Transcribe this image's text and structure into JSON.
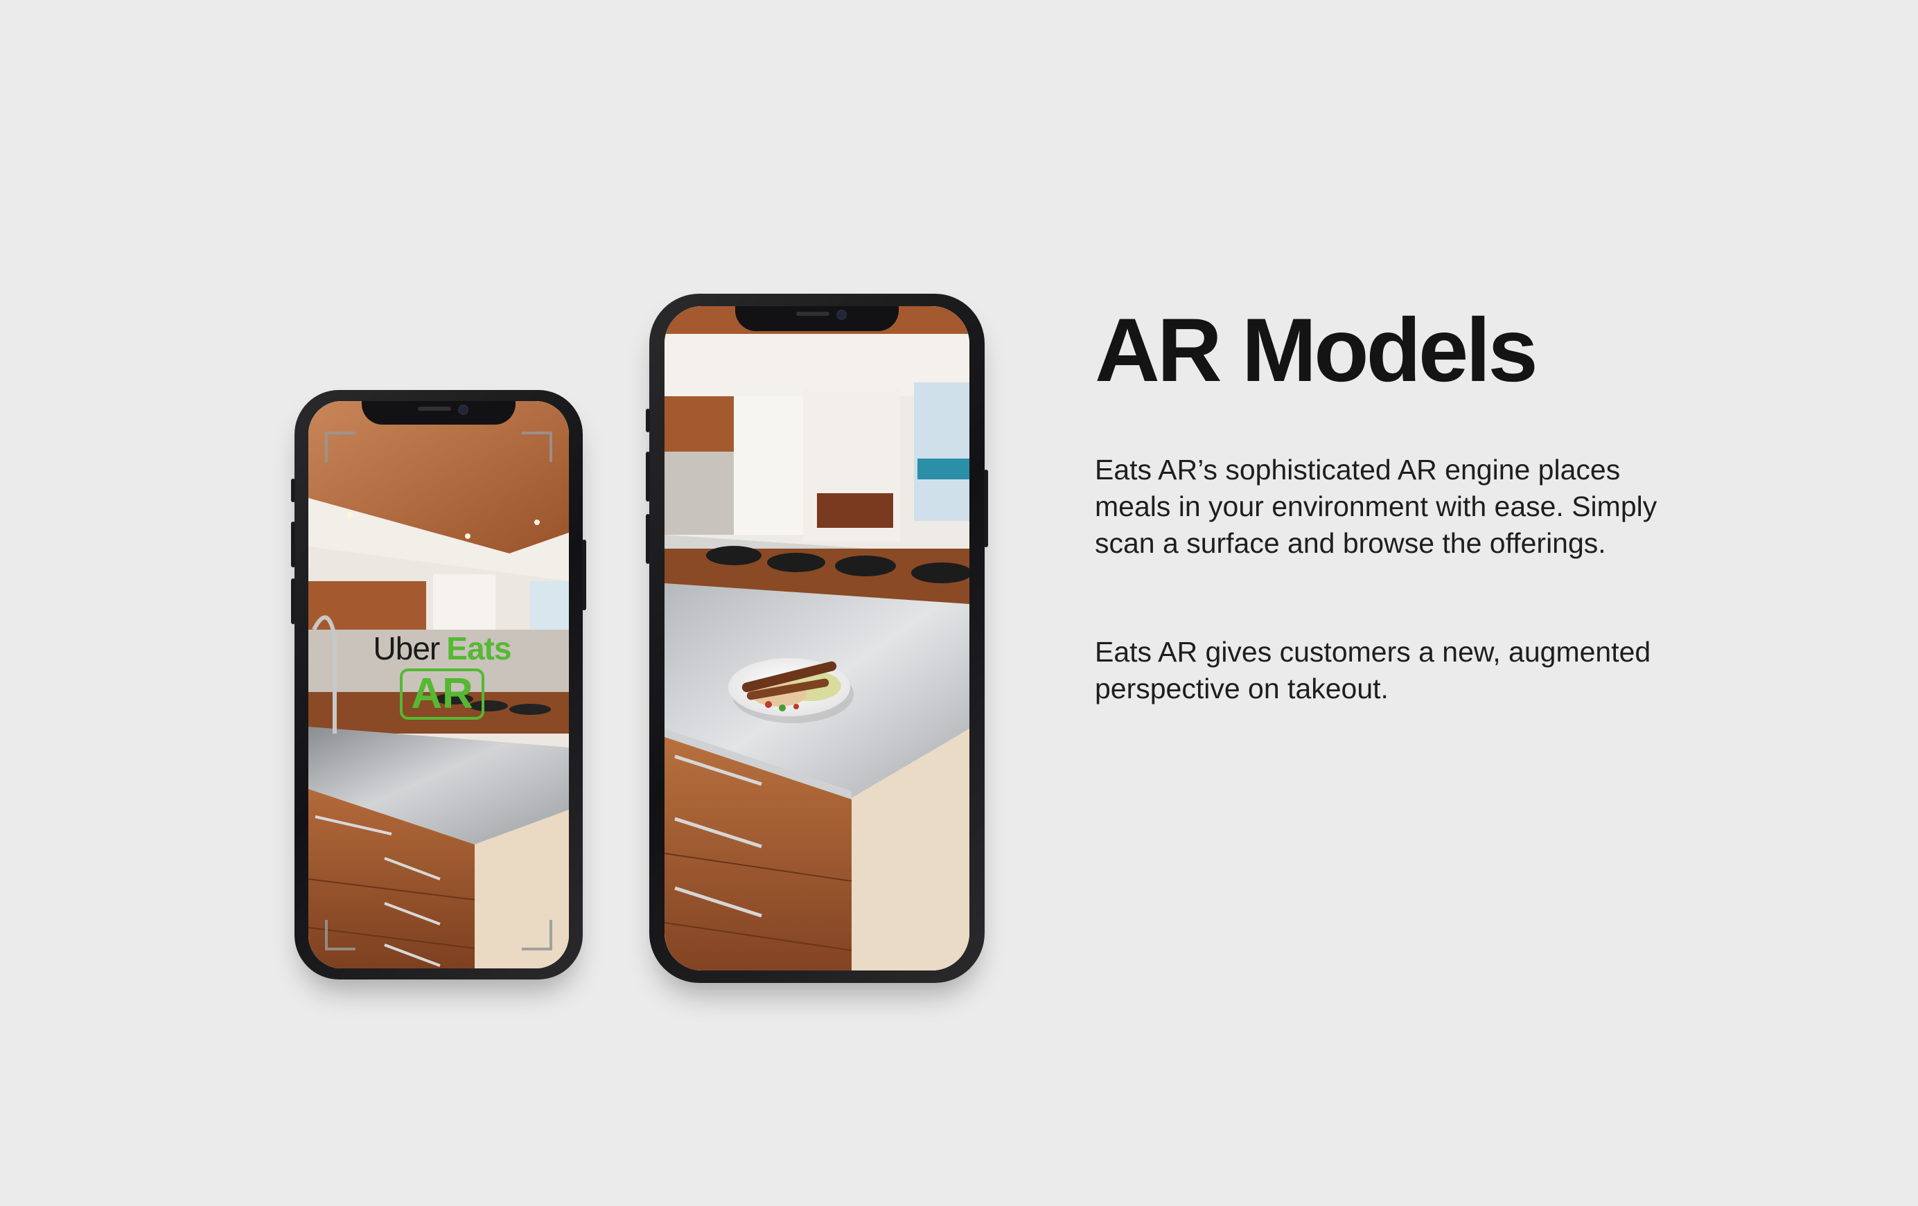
{
  "heading": "AR Models",
  "paragraphs": [
    "Eats AR’s sophisticated AR engine places meals in your environment with ease. Simply scan a surface and browse the offerings.",
    "Eats AR gives customers a new, augmented perspective on takeout."
  ],
  "app_logo": {
    "brand": "Uber",
    "product": "Eats",
    "badge": "AR"
  },
  "colors": {
    "background": "#ebebeb",
    "brand_green": "#56b833",
    "text": "#141414"
  }
}
